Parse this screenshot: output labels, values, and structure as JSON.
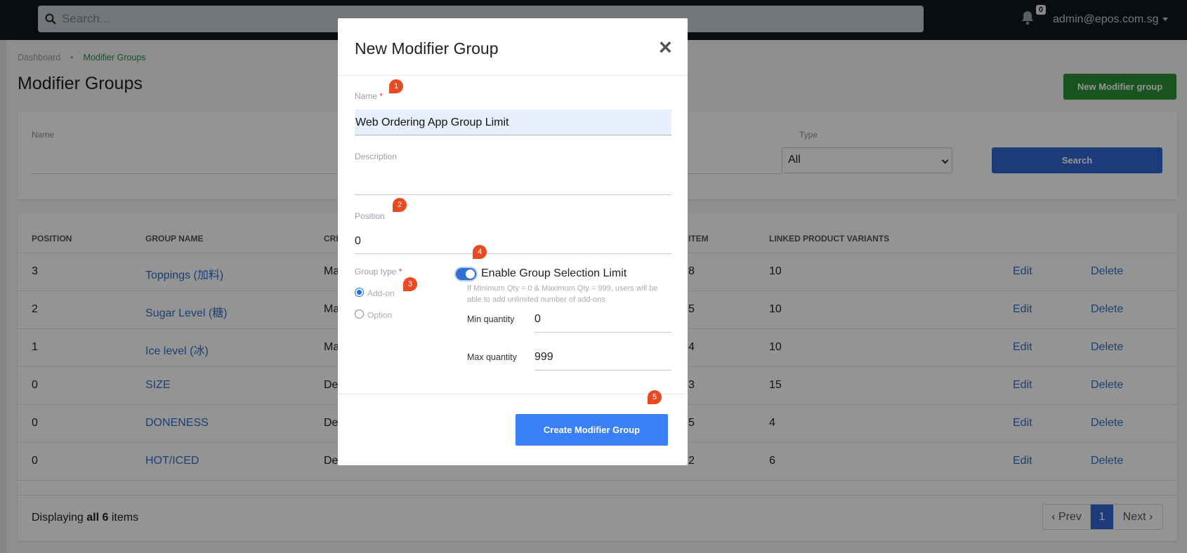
{
  "topbar": {
    "search_placeholder": "Search...",
    "notification_count": "0",
    "user_email": "admin@epos.com.sg"
  },
  "breadcrumb": {
    "home": "Dashboard",
    "current": "Modifier Groups"
  },
  "page": {
    "title": "Modifier Groups",
    "new_button": "New Modifier group"
  },
  "filters": {
    "name_label": "Name",
    "type_label": "Type",
    "type_value": "All",
    "search_button": "Search"
  },
  "table": {
    "headers": [
      "POSITION",
      "GROUP NAME",
      "CRE",
      "ITEM",
      "LINKED PRODUCT VARIANTS"
    ],
    "rows": [
      {
        "position": "3",
        "name": "Toppings (加料)",
        "cre": "Ma",
        "item": "8",
        "variants": "10",
        "edit": "Edit",
        "delete": "Delete"
      },
      {
        "position": "2",
        "name": "Sugar Level (糖)",
        "cre": "Ma",
        "item": "5",
        "variants": "10",
        "edit": "Edit",
        "delete": "Delete"
      },
      {
        "position": "1",
        "name": "Ice level (冰)",
        "cre": "Ma",
        "item": "4",
        "variants": "10",
        "edit": "Edit",
        "delete": "Delete"
      },
      {
        "position": "0",
        "name": "SIZE",
        "cre": "De",
        "item": "3",
        "variants": "15",
        "edit": "Edit",
        "delete": "Delete"
      },
      {
        "position": "0",
        "name": "DONENESS",
        "cre": "De",
        "item": "5",
        "variants": "4",
        "edit": "Edit",
        "delete": "Delete"
      },
      {
        "position": "0",
        "name": "HOT/ICED",
        "cre": "De",
        "item": "2",
        "variants": "6",
        "edit": "Edit",
        "delete": "Delete"
      }
    ],
    "display_prefix": "Displaying ",
    "display_bold": "all 6",
    "display_suffix": " items",
    "pager": {
      "prev": "‹ Prev",
      "page": "1",
      "next": "Next ›"
    }
  },
  "modal": {
    "title": "New Modifier Group",
    "close": "×",
    "name_label": "Name",
    "name_value": "Web Ordering App Group Limit",
    "description_label": "Description",
    "position_label": "Position",
    "position_value": "0",
    "group_type_label": "Group type",
    "group_type_options": [
      "Add-on",
      "Option"
    ],
    "group_type_selected": "Add-on",
    "toggle_label": "Enable Group Selection Limit",
    "toggle_on": true,
    "hint": "If Minimum Qty = 0 & Maximum Qty = 999, users will be able to add unlimited number of add-ons",
    "min_label": "Min quantity",
    "min_value": "0",
    "max_label": "Max quantity",
    "max_value": "999",
    "create_button": "Create Modifier Group"
  },
  "markers": [
    "1",
    "2",
    "3",
    "4",
    "5"
  ],
  "colors": {
    "primary": "#3366d1",
    "success": "#2c8f36",
    "marker": "#e84a24",
    "link": "#2f6fc9"
  }
}
